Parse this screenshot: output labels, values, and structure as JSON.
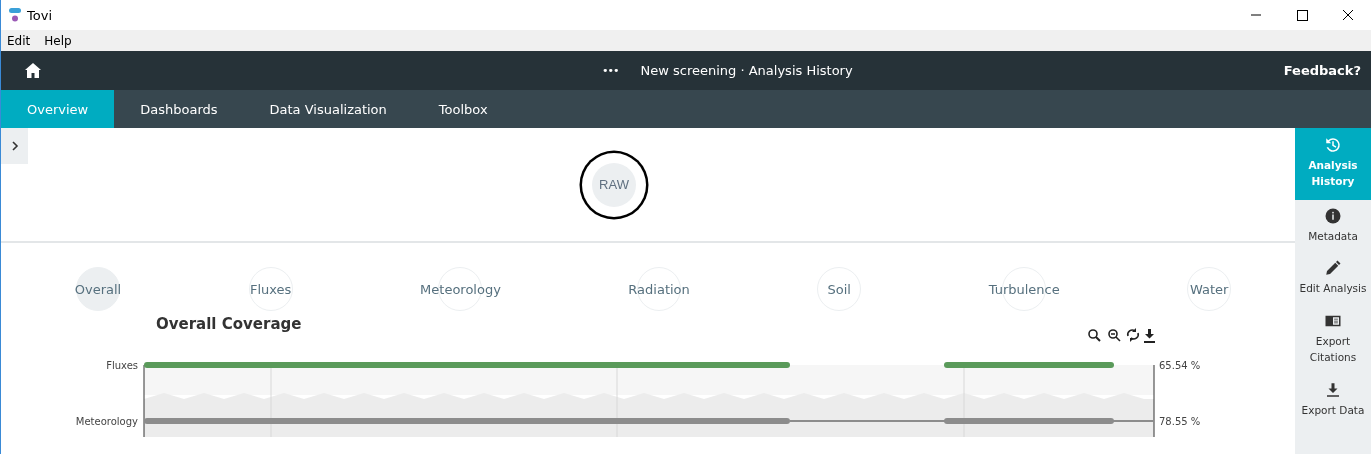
{
  "window": {
    "title": "Tovi"
  },
  "menu": [
    "Edit",
    "Help"
  ],
  "top_bar": {
    "more": "•••",
    "title": "New screening · Analysis History",
    "feedback": "Feedback?"
  },
  "tabs": [
    {
      "label": "Overview",
      "selected": true
    },
    {
      "label": "Dashboards",
      "selected": false
    },
    {
      "label": "Data Visualization",
      "selected": false
    },
    {
      "label": "Toolbox",
      "selected": false
    }
  ],
  "stage": {
    "label": "RAW",
    "selected": true
  },
  "categories": [
    {
      "label": "Overall",
      "selected": true
    },
    {
      "label": "Fluxes",
      "selected": false
    },
    {
      "label": "Meteorology",
      "selected": false
    },
    {
      "label": "Radiation",
      "selected": false
    },
    {
      "label": "Soil",
      "selected": false
    },
    {
      "label": "Turbulence",
      "selected": false
    },
    {
      "label": "Water",
      "selected": false
    }
  ],
  "coverage": {
    "title": "Overall Coverage",
    "rows": [
      {
        "name": "Fluxes",
        "reading": "65.54 %",
        "color": "#5a9a5a"
      },
      {
        "name": "Meteorology",
        "reading": "78.55 %",
        "color": "#8c8c8c"
      }
    ]
  },
  "sidebar": [
    {
      "label": "Analysis History",
      "selected": true
    },
    {
      "label": "Metadata",
      "selected": false
    },
    {
      "label": "Edit Analysis",
      "selected": false
    },
    {
      "label": "Export Citations",
      "selected": false
    },
    {
      "label": "Export Data",
      "selected": false
    }
  ]
}
